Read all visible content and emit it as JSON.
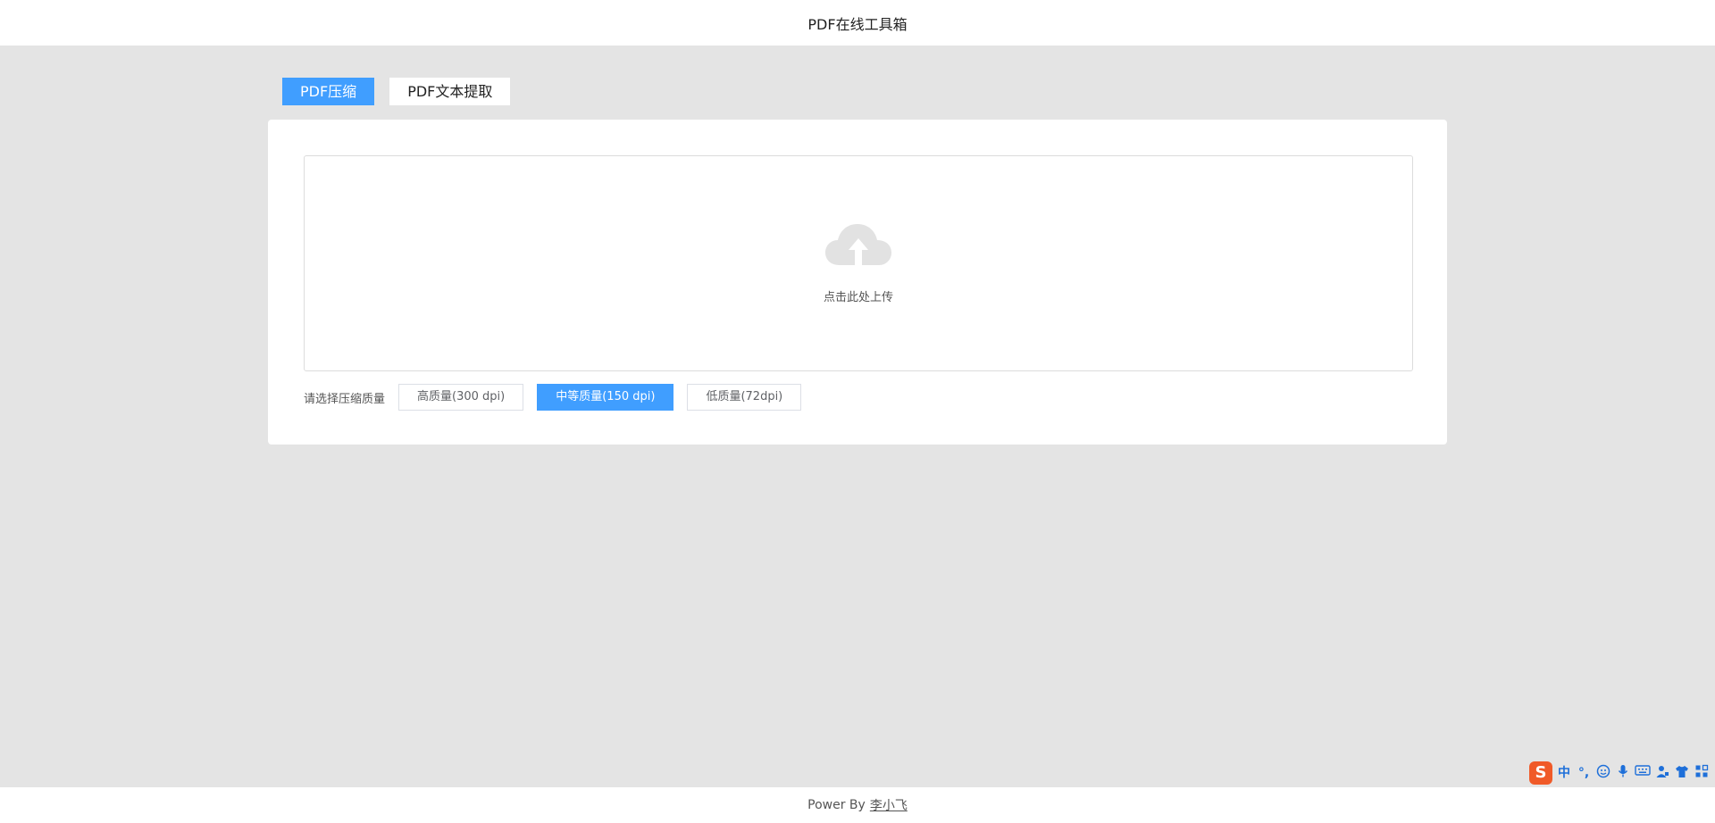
{
  "header": {
    "title": "PDF在线工具箱"
  },
  "tabs": [
    {
      "label": "PDF压缩",
      "active": true
    },
    {
      "label": "PDF文本提取",
      "active": false
    }
  ],
  "upload": {
    "text": "点击此处上传",
    "icon": "cloud-upload-icon"
  },
  "quality": {
    "label": "请选择压缩质量",
    "options": [
      {
        "label": "高质量(300 dpi)",
        "active": false
      },
      {
        "label": "中等质量(150 dpi)",
        "active": true
      },
      {
        "label": "低质量(72dpi)",
        "active": false
      }
    ]
  },
  "footer": {
    "prefix": "Power By",
    "author": "李小飞"
  },
  "ime": {
    "logo": "S",
    "mode": "中",
    "punct": "°,",
    "icons": [
      "emoji-icon",
      "microphone-icon",
      "keyboard-icon",
      "user-icon",
      "skin-icon",
      "grid-icon"
    ]
  },
  "colors": {
    "accent": "#409eff",
    "background": "#e4e4e4",
    "panel": "#ffffff"
  }
}
